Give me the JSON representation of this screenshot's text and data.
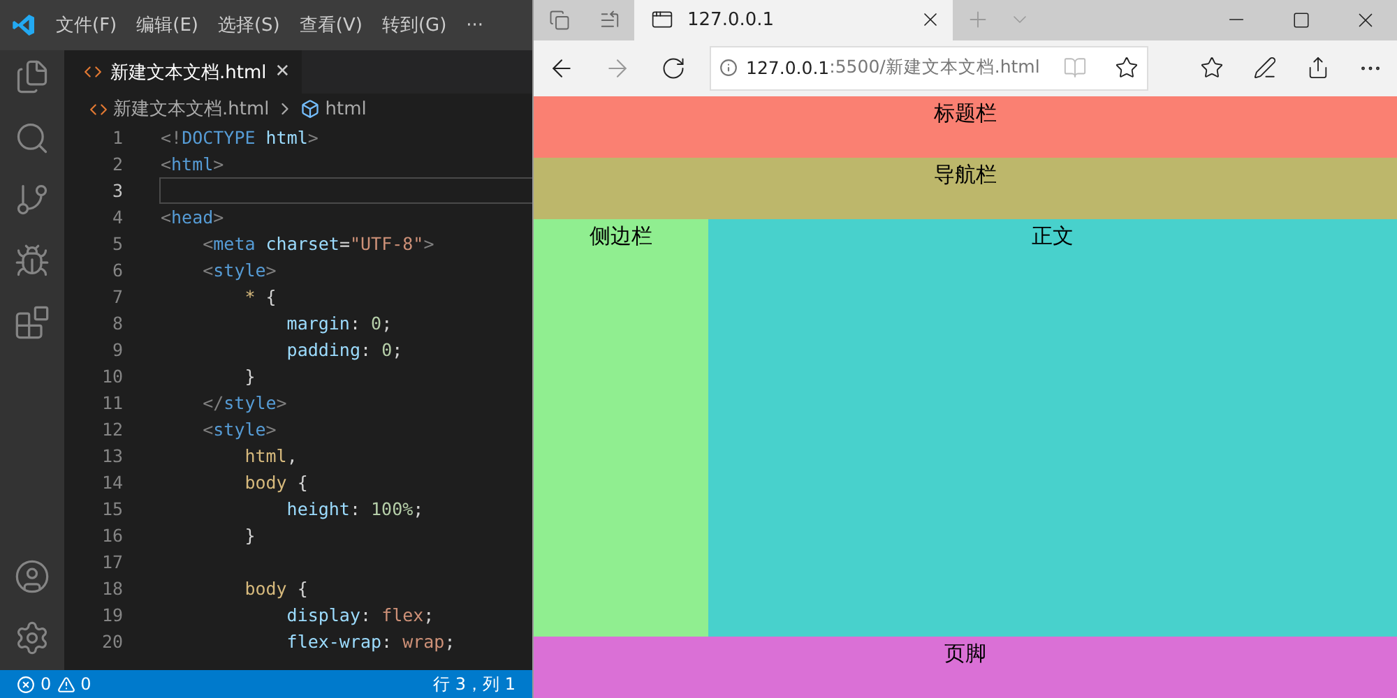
{
  "editor": {
    "menu": [
      "文件(F)",
      "编辑(E)",
      "选择(S)",
      "查看(V)",
      "转到(G)",
      "···"
    ],
    "activity": [
      {
        "kind": "files",
        "selected": false
      },
      {
        "kind": "search",
        "selected": false
      },
      {
        "kind": "git",
        "selected": false
      },
      {
        "kind": "debug",
        "selected": false
      },
      {
        "kind": "extensions",
        "selected": false
      }
    ],
    "tab": {
      "title": "新建文本文档.html",
      "close": "✕",
      "selected": true
    },
    "breadcrumb": [
      "新建文本文档.html",
      "html"
    ],
    "lines": [
      {
        "number": "1",
        "current": false,
        "tokens": [
          {
            "t": "<!",
            "color": "#808080"
          },
          {
            "t": "DOCTYPE",
            "color": "#569cd6"
          },
          {
            "t": " html",
            "color": "#9cdcfe"
          },
          {
            "t": ">",
            "color": "#808080"
          }
        ]
      },
      {
        "number": "2",
        "current": false,
        "tokens": [
          {
            "t": "<",
            "color": "#808080"
          },
          {
            "t": "html",
            "color": "#569cd6"
          },
          {
            "t": ">",
            "color": "#808080"
          }
        ]
      },
      {
        "number": "3",
        "current": true
      },
      {
        "number": "4",
        "current": false,
        "tokens": [
          {
            "t": "<",
            "color": "#808080"
          },
          {
            "t": "head",
            "color": "#569cd6"
          },
          {
            "t": ">",
            "color": "#808080"
          }
        ]
      },
      {
        "number": "5",
        "current": false,
        "tokens": [
          {
            "t": "    <",
            "color": "#808080"
          },
          {
            "t": "meta",
            "color": "#569cd6"
          },
          {
            "t": " charset",
            "color": "#9cdcfe"
          },
          {
            "t": "=",
            "color": "#d4d4d4"
          },
          {
            "t": "\"UTF-8\"",
            "color": "#ce9178"
          },
          {
            "t": ">",
            "color": "#808080"
          }
        ]
      },
      {
        "number": "6",
        "current": false,
        "tokens": [
          {
            "t": "    <",
            "color": "#808080"
          },
          {
            "t": "style",
            "color": "#569cd6"
          },
          {
            "t": ">",
            "color": "#808080"
          }
        ]
      },
      {
        "number": "7",
        "current": false,
        "tokens": [
          {
            "t": "        *",
            "color": "#d7ba7d"
          },
          {
            "t": " {",
            "color": "#d4d4d4"
          }
        ]
      },
      {
        "number": "8",
        "current": false,
        "tokens": [
          {
            "t": "            margin",
            "color": "#9cdcfe"
          },
          {
            "t": ": ",
            "color": "#d4d4d4"
          },
          {
            "t": "0",
            "color": "#b5cea8"
          },
          {
            "t": ";",
            "color": "#d4d4d4"
          }
        ]
      },
      {
        "number": "9",
        "current": false,
        "tokens": [
          {
            "t": "            padding",
            "color": "#9cdcfe"
          },
          {
            "t": ": ",
            "color": "#d4d4d4"
          },
          {
            "t": "0",
            "color": "#b5cea8"
          },
          {
            "t": ";",
            "color": "#d4d4d4"
          }
        ]
      },
      {
        "number": "10",
        "current": false,
        "tokens": [
          {
            "t": "        }",
            "color": "#d4d4d4"
          }
        ]
      },
      {
        "number": "11",
        "current": false,
        "tokens": [
          {
            "t": "    </",
            "color": "#808080"
          },
          {
            "t": "style",
            "color": "#569cd6"
          },
          {
            "t": ">",
            "color": "#808080"
          }
        ]
      },
      {
        "number": "12",
        "current": false,
        "tokens": [
          {
            "t": "    <",
            "color": "#808080"
          },
          {
            "t": "style",
            "color": "#569cd6"
          },
          {
            "t": ">",
            "color": "#808080"
          }
        ]
      },
      {
        "number": "13",
        "current": false,
        "tokens": [
          {
            "t": "        html",
            "color": "#d7ba7d"
          },
          {
            "t": ",",
            "color": "#d4d4d4"
          }
        ]
      },
      {
        "number": "14",
        "current": false,
        "tokens": [
          {
            "t": "        body",
            "color": "#d7ba7d"
          },
          {
            "t": " {",
            "color": "#d4d4d4"
          }
        ]
      },
      {
        "number": "15",
        "current": false,
        "tokens": [
          {
            "t": "            height",
            "color": "#9cdcfe"
          },
          {
            "t": ": ",
            "color": "#d4d4d4"
          },
          {
            "t": "100%",
            "color": "#b5cea8"
          },
          {
            "t": ";",
            "color": "#d4d4d4"
          }
        ]
      },
      {
        "number": "16",
        "current": false,
        "tokens": [
          {
            "t": "        }",
            "color": "#d4d4d4"
          }
        ]
      },
      {
        "number": "17",
        "current": false
      },
      {
        "number": "18",
        "current": false,
        "tokens": [
          {
            "t": "        body",
            "color": "#d7ba7d"
          },
          {
            "t": " {",
            "color": "#d4d4d4"
          }
        ]
      },
      {
        "number": "19",
        "current": false,
        "tokens": [
          {
            "t": "            display",
            "color": "#9cdcfe"
          },
          {
            "t": ": ",
            "color": "#d4d4d4"
          },
          {
            "t": "flex",
            "color": "#ce9178"
          },
          {
            "t": ";",
            "color": "#d4d4d4"
          }
        ]
      },
      {
        "number": "20",
        "current": false,
        "tokens": [
          {
            "t": "            flex-wrap",
            "color": "#9cdcfe"
          },
          {
            "t": ": ",
            "color": "#d4d4d4"
          },
          {
            "t": "wrap",
            "color": "#ce9178"
          },
          {
            "t": ";",
            "color": "#d4d4d4"
          }
        ]
      }
    ],
    "status": {
      "errors": "0",
      "warnings": "0",
      "position": "行 3，列 1"
    }
  },
  "browser": {
    "tab": {
      "title": "127.0.0.1",
      "selected": true
    },
    "address": {
      "host": "127.0.0.1",
      "path": ":5500/新建文本文档.html"
    },
    "page": [
      {
        "kind": "header",
        "label": "标题栏",
        "color": "#fa8072"
      },
      {
        "kind": "nav",
        "label": "导航栏",
        "color": "#bdb76b"
      },
      {
        "kind": "sidebar",
        "label": "侧边栏",
        "color": "#90ee90"
      },
      {
        "kind": "main",
        "label": "正文",
        "color": "#48d1cc"
      },
      {
        "kind": "footer",
        "label": "页脚",
        "color": "#da70d6"
      }
    ]
  }
}
